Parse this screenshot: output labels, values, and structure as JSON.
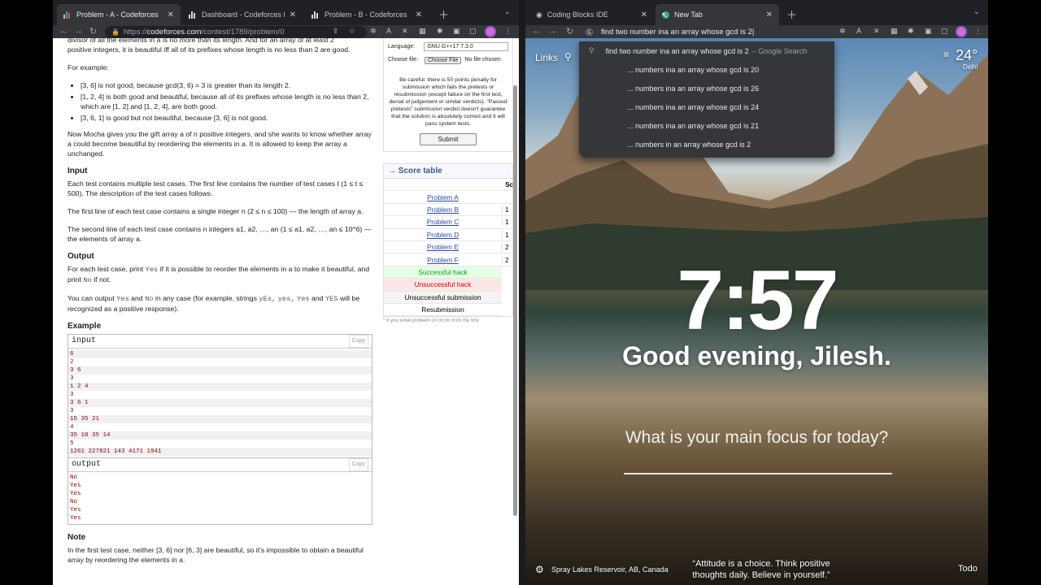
{
  "left": {
    "tabs": [
      {
        "label": "Problem - A - Codeforces"
      },
      {
        "label": "Dashboard - Codeforces Roun"
      },
      {
        "label": "Problem - B - Codeforces"
      }
    ],
    "url_prefix": "https://",
    "url_host": "codeforces.com",
    "url_path": "/contest/1789/problem/0",
    "statement": {
      "intro_line1": "divisor of all the elements in a is no more than its length. And for an array of at least 2",
      "intro_line2": "positive integers, it is beautiful iff all of its prefixes whose length is no less than 2 are good.",
      "for_example": "For example:",
      "bullets": [
        "[3, 6] is not good, because gcd(3, 6) = 3 is greater than its length 2.",
        "[1, 2, 4] is both good and beautiful, because all of its prefixes whose length is no less than 2, which are [1, 2] and [1, 2, 4], are both good.",
        "[3, 6, 1] is good but not beautiful, because [3, 6] is not good."
      ],
      "mocha": "Now Mocha gives you the gift array a of n positive integers, and she wants to know whether array a could become beautiful by reordering the elements in a. It is allowed to keep the array a unchanged.",
      "input_h": "Input",
      "input_p1": "Each test contains multiple test cases. The first line contains the number of test cases t (1 ≤ t ≤ 500). The description of the test cases follows.",
      "input_p2": "The first line of each test case contains a single integer n (2 ≤ n ≤ 100) — the length of array a.",
      "input_p3": "The second line of each test case contains n integers a1, a2, …, an (1 ≤ a1, a2, …, an ≤ 10^6) — the elements of array a.",
      "output_h": "Output",
      "output_p1a": "For each test case, print",
      "yes": "Yes",
      "output_p1b": "if it is possible to reorder the elements in a to make it beautiful, and print",
      "no": "No",
      "output_p1c": "if not.",
      "output_p2a": "You can output",
      "output_p2b": "and",
      "output_p2c": "in any case (for example, strings",
      "case_yes1": "yEs,",
      "case_yes2": "yes,",
      "case_yes3": "Yes",
      "output_p2d": "and",
      "case_yes4": "YES",
      "output_p2e": "will be recognized as a positive response).",
      "example_h": "Example",
      "input_title": "input",
      "output_title": "output",
      "copy": "Copy",
      "input_lines": [
        "6",
        "2",
        "3 6",
        "3",
        "1 2 4",
        "3",
        "3 6 1",
        "3",
        "15 35 21",
        "4",
        "35 10 35 14",
        "5",
        "1261 227821 143 4171 1941"
      ],
      "output_lines": [
        "No",
        "Yes",
        "Yes",
        "No",
        "Yes",
        "Yes"
      ],
      "note_h": "Note",
      "note_p": "In the first test case, neither [3, 6] nor [6, 3] are beautiful, so it's impossible to obtain a beautiful array by reordering the elements in a."
    },
    "sidebar": {
      "language_label": "Language:",
      "language_value": "GNU G++17 7.3.0",
      "choose_label": "Choose file:",
      "choose_button": "Choose File",
      "no_file": "No file chosen",
      "careful": "Be careful: there is 50 points penalty for submission which fails the pretests or resubmission (except failure on the first test, denial of judgement or similar verdicts). \"Passed pretests\" submission verdict doesn't guarantee that the solution is absolutely correct and it will pass system tests.",
      "submit": "Submit",
      "score_title": "→ Score table",
      "score_col": "Sc",
      "problems": [
        {
          "name": "Problem A",
          "val": ""
        },
        {
          "name": "Problem B",
          "val": "1"
        },
        {
          "name": "Problem C",
          "val": "1"
        },
        {
          "name": "Problem D",
          "val": "1"
        },
        {
          "name": "Problem E",
          "val": "2"
        },
        {
          "name": "Problem F",
          "val": "2"
        }
      ],
      "successful_hack": "Successful hack",
      "unsuccessful_hack": "Unsuccessful hack",
      "unsuccessful_submission": "Unsuccessful submission",
      "resubmission": "Resubmission",
      "footnote": "* If you solve problem on 00:00 from the first"
    }
  },
  "right": {
    "tabs": [
      {
        "label": "Coding Blocks IDE"
      },
      {
        "label": "New Tab"
      }
    ],
    "omnibox_text": "find two number ina an array whose gcd is 2",
    "suggestions": [
      {
        "text": "find two number ina an array whose gcd is 2",
        "suffix": "– Google Search"
      },
      {
        "text": "... numbers ina an array whose gcd is 20",
        "suffix": ""
      },
      {
        "text": "... numbers ina an array whose gcd is 26",
        "suffix": ""
      },
      {
        "text": "... numbers ina an array whose gcd is 24",
        "suffix": ""
      },
      {
        "text": "... numbers ina an array whose gcd is 21",
        "suffix": ""
      },
      {
        "text": "... numbers in an array whose gcd is 2",
        "suffix": ""
      }
    ],
    "links": "Links",
    "temp": "24°",
    "city": "Delhi",
    "clock": "7:57",
    "greeting": "Good evening, Jilesh.",
    "focus_q": "What is your main focus for today?",
    "location": "Spray Lakes Reservoir, AB, Canada",
    "quote_line1": "“Attitude is a choice. Think positive",
    "quote_line2": "thoughts daily. Believe in yourself.”",
    "todo": "Todo"
  }
}
